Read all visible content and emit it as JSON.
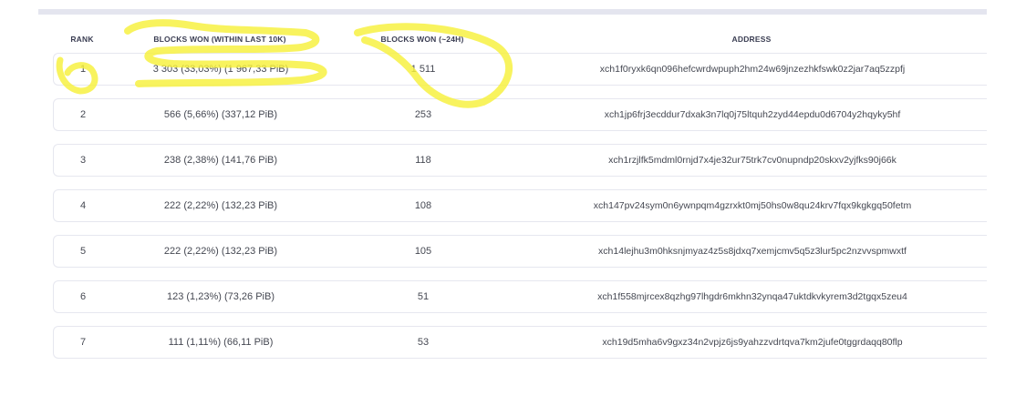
{
  "table": {
    "headers": {
      "rank": "RANK",
      "blocks_won": "BLOCKS WON (WITHIN LAST 10K)",
      "blocks_won_24h": "BLOCKS WON (~24H)",
      "address": "ADDRESS"
    },
    "rows": [
      {
        "rank": "1",
        "blocks_won": "3 303 (33,03%) (1 967,33 PiB)",
        "blocks_won_24h": "1 511",
        "address": "xch1f0ryxk6qn096hefcwrdwpuph2hm24w69jnzezhkfswk0z2jar7aq5zzpfj"
      },
      {
        "rank": "2",
        "blocks_won": "566 (5,66%) (337,12 PiB)",
        "blocks_won_24h": "253",
        "address": "xch1jp6frj3ecddur7dxak3n7lq0j75ltquh2zyd44epdu0d6704y2hqyky5hf"
      },
      {
        "rank": "3",
        "blocks_won": "238 (2,38%) (141,76 PiB)",
        "blocks_won_24h": "118",
        "address": "xch1rzjlfk5mdml0rnjd7x4je32ur75trk7cv0nupndp20skxv2yjfks90j66k"
      },
      {
        "rank": "4",
        "blocks_won": "222 (2,22%) (132,23 PiB)",
        "blocks_won_24h": "108",
        "address": "xch147pv24sym0n6ywnpqm4gzrxkt0mj50hs0w8qu24krv7fqx9kgkgq50fetm"
      },
      {
        "rank": "5",
        "blocks_won": "222 (2,22%) (132,23 PiB)",
        "blocks_won_24h": "105",
        "address": "xch14lejhu3m0hksnjmyaz4z5s8jdxq7xemjcmv5q5z3lur5pc2nzvvspmwxtf"
      },
      {
        "rank": "6",
        "blocks_won": "123 (1,23%) (73,26 PiB)",
        "blocks_won_24h": "51",
        "address": "xch1f558mjrcex8qzhg97lhgdr6mkhn32ynqa47uktdkvkyrem3d2tgqx5zeu4"
      },
      {
        "rank": "7",
        "blocks_won": "111 (1,11%) (66,11 PiB)",
        "blocks_won_24h": "53",
        "address": "xch19d5mha6v9gxz34n2vpjz6js9yahzzvdrtqva7km2jufe0tggrdaqq80flp"
      }
    ]
  },
  "colors": {
    "highlighter": "#f7f03a",
    "row_border": "#e6e7ef",
    "top_bar": "#e4e5ef"
  }
}
